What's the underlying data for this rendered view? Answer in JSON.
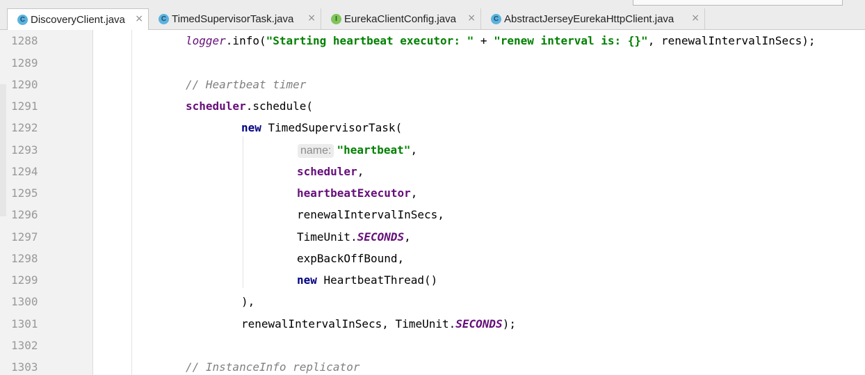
{
  "tabs": [
    {
      "label": "DiscoveryClient.java",
      "icon": "C",
      "icon_name": "class-icon",
      "active": true
    },
    {
      "label": "TimedSupervisorTask.java",
      "icon": "C",
      "icon_name": "class-icon",
      "active": false
    },
    {
      "label": "EurekaClientConfig.java",
      "icon": "I",
      "icon_name": "interface-icon",
      "active": false
    },
    {
      "label": "AbstractJerseyEurekaHttpClient.java",
      "icon": "C",
      "icon_name": "class-icon",
      "active": false
    }
  ],
  "close_glyph": "×",
  "line_numbers": [
    "1288",
    "1289",
    "1290",
    "1291",
    "1292",
    "1293",
    "1294",
    "1295",
    "1296",
    "1297",
    "1298",
    "1299",
    "1300",
    "1301",
    "1302",
    "1303"
  ],
  "code": {
    "l1288": {
      "a": "logger",
      "b": ".info(",
      "c": "\"Starting heartbeat executor: \"",
      "d": " + ",
      "e": "\"renew interval is: {}\"",
      "f": ", renewalIntervalInSecs);"
    },
    "l1290": "// Heartbeat timer",
    "l1291": {
      "a": "scheduler",
      "b": ".schedule("
    },
    "l1292": {
      "a": "new",
      "b": " TimedSupervisorTask("
    },
    "l1293": {
      "hint": "name:",
      "str": "\"heartbeat\"",
      "rest": ","
    },
    "l1294": {
      "a": "scheduler",
      "b": ","
    },
    "l1295": {
      "a": "heartbeatExecutor",
      "b": ","
    },
    "l1296": "renewalIntervalInSecs,",
    "l1297": {
      "a": "TimeUnit.",
      "b": "SECONDS",
      "c": ","
    },
    "l1298": "expBackOffBound,",
    "l1299": {
      "a": "new",
      "b": " HeartbeatThread()"
    },
    "l1300": "),",
    "l1301": {
      "a": "renewalIntervalInSecs, TimeUnit.",
      "b": "SECONDS",
      "c": ");"
    },
    "l1303": "// InstanceInfo replicator"
  },
  "colors": {
    "keyword": "#000080",
    "string": "#008000",
    "field": "#660e7a",
    "comment": "#808080",
    "line_number": "#999999"
  }
}
